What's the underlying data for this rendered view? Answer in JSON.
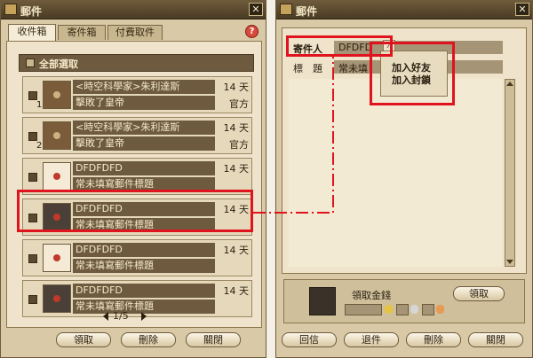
{
  "left_window": {
    "title": "郵件",
    "close": "✕",
    "tabs": [
      "收件箱",
      "寄件箱",
      "付費取件"
    ],
    "help": "?",
    "select_all": "全部選取",
    "mails": [
      {
        "title": "<時空科學家>朱利達斯",
        "days": "14 天",
        "subject": "擊敗了皇帝",
        "source": "官方",
        "badge": "1",
        "thumb_icon": "package-icon"
      },
      {
        "title": "<時空科學家>朱利達斯",
        "days": "14 天",
        "subject": "擊敗了皇帝",
        "source": "官方",
        "badge": "2",
        "thumb_icon": "package-icon"
      },
      {
        "title": "DFDFDFD",
        "days": "14 天",
        "subject": "常未填寫郵件標題",
        "source": "",
        "badge": "",
        "thumb_icon": "envelope-open-icon"
      },
      {
        "title": "DFDFDFD",
        "days": "14 天",
        "subject": "常未填寫郵件標題",
        "source": "",
        "badge": "",
        "thumb_icon": "envelope-dark-icon"
      },
      {
        "title": "DFDFDFD",
        "days": "14 天",
        "subject": "常未填寫郵件標題",
        "source": "",
        "badge": "",
        "thumb_icon": "envelope-open-icon"
      },
      {
        "title": "DFDFDFD",
        "days": "14 天",
        "subject": "常未填寫郵件標題",
        "source": "",
        "badge": "",
        "thumb_icon": "envelope-dark-icon"
      }
    ],
    "page": "1/5",
    "buttons": {
      "take": "領取",
      "delete": "刪除",
      "close": "關閉"
    }
  },
  "right_window": {
    "title": "郵件",
    "close": "✕",
    "sender_label": "寄件人",
    "sender_value": "DFDFD",
    "subject_label": "標　題",
    "subject_value": "常未填",
    "context_menu": [
      "加入好友",
      "加入封鎖"
    ],
    "take_money_label": "領取金錢",
    "take_button": "領取",
    "buttons": {
      "reply": "回信",
      "return": "退件",
      "delete": "刪除",
      "close": "關閉"
    }
  },
  "colors": {
    "highlight": "#e0141e",
    "title_bg": "#4a3b24",
    "panel_bg": "#efe4cb"
  }
}
